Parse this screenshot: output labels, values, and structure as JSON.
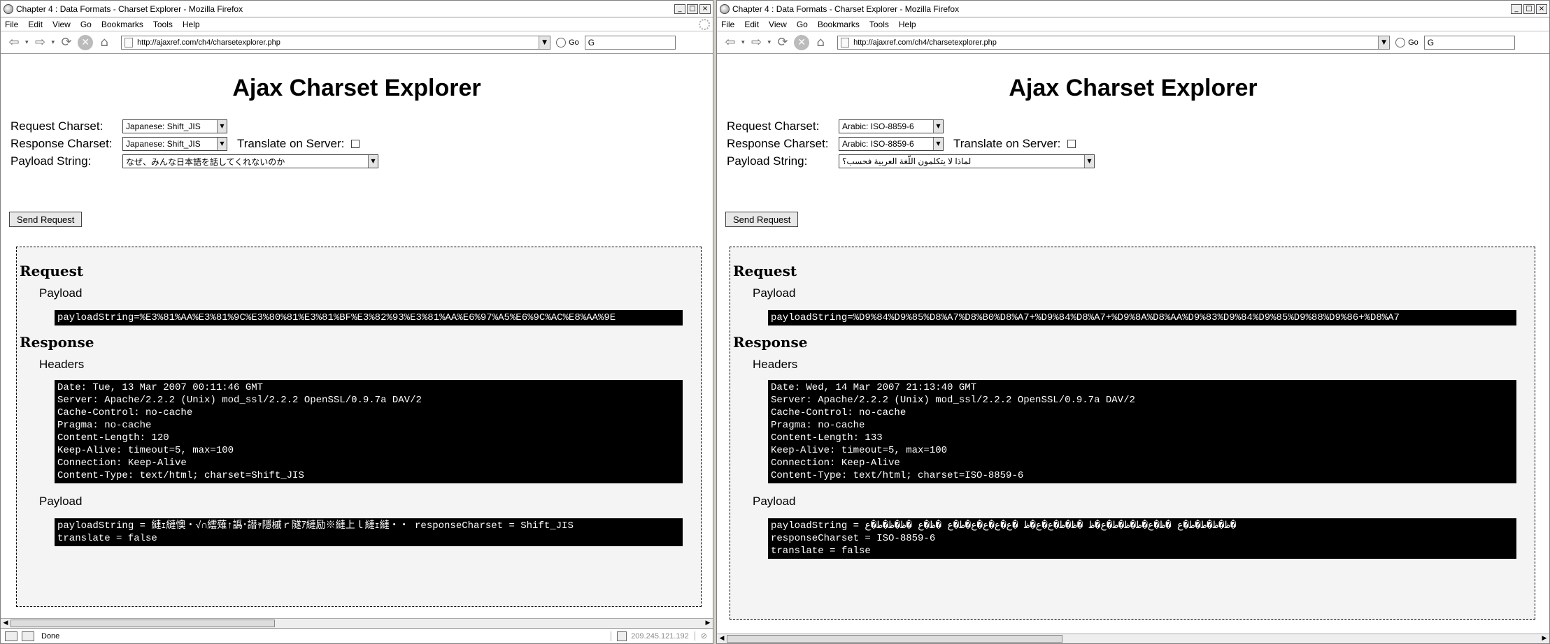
{
  "left": {
    "window_title": "Chapter 4 : Data Formats - Charset Explorer - Mozilla Firefox",
    "menu": [
      "File",
      "Edit",
      "View",
      "Go",
      "Bookmarks",
      "Tools",
      "Help"
    ],
    "url": "http://ajaxref.com/ch4/charsetexplorer.php",
    "go_label": "Go",
    "search_value": "G",
    "heading": "Ajax Charset Explorer",
    "request_charset_label": "Request Charset:",
    "request_charset_value": "Japanese: Shift_JIS",
    "response_charset_label": "Response Charset:",
    "response_charset_value": "Japanese: Shift_JIS",
    "translate_label": "Translate on Server:",
    "translate_checked": false,
    "payload_label": "Payload String:",
    "payload_value": "なぜ、みんな日本語を話してくれないのか",
    "send_button": "Send Request",
    "request_heading": "Request",
    "request_payload_heading": "Payload",
    "request_payload": "payloadString=%E3%81%AA%E3%81%9C%E3%80%81%E3%81%BF%E3%82%93%E3%81%AA%E6%97%A5%E6%9C%AC%E8%AA%9E",
    "response_heading": "Response",
    "headers_heading": "Headers",
    "headers": "Date: Tue, 13 Mar 2007 00:11:46 GMT\nServer: Apache/2.2.2 (Unix) mod_ssl/2.2.2 OpenSSL/0.9.7a DAV/2\nCache-Control: no-cache\nPragma: no-cache\nContent-Length: 120\nKeep-Alive: timeout=5, max=100\nConnection: Keep-Alive\nContent-Type: text/html; charset=Shift_JIS",
    "response_payload_heading": "Payload",
    "response_payload": "payloadString = 縺ｪ縺懊・√∩繧薙↑譌･譛ｬ隱槭ｒ隧ｱ縺励※縺上ｌ縺ｪ縺・・ responseCharset = Shift_JIS\ntranslate = false",
    "status_text": "Done",
    "status_ip": "209.245.121.192"
  },
  "right": {
    "window_title": "Chapter 4 : Data Formats - Charset Explorer - Mozilla Firefox",
    "menu": [
      "File",
      "Edit",
      "View",
      "Go",
      "Bookmarks",
      "Tools",
      "Help"
    ],
    "url": "http://ajaxref.com/ch4/charsetexplorer.php",
    "go_label": "Go",
    "search_value": "G",
    "heading": "Ajax Charset Explorer",
    "request_charset_label": "Request Charset:",
    "request_charset_value": "Arabic: ISO-8859-6",
    "response_charset_label": "Response Charset:",
    "response_charset_value": "Arabic: ISO-8859-6",
    "translate_label": "Translate on Server:",
    "translate_checked": false,
    "payload_label": "Payload String:",
    "payload_value": "لماذا لا يتكلمون اللّغة العربية فحسب؟",
    "send_button": "Send Request",
    "request_heading": "Request",
    "request_payload_heading": "Payload",
    "request_payload": "payloadString=%D9%84%D9%85%D8%A7%D8%B0%D8%A7+%D9%84%D8%A7+%D9%8A%D8%AA%D9%83%D9%84%D9%85%D9%88%D9%86+%D8%A7",
    "response_heading": "Response",
    "headers_heading": "Headers",
    "headers": "Date: Wed, 14 Mar 2007 21:13:40 GMT\nServer: Apache/2.2.2 (Unix) mod_ssl/2.2.2 OpenSSL/0.9.7a DAV/2\nCache-Control: no-cache\nPragma: no-cache\nContent-Length: 133\nKeep-Alive: timeout=5, max=100\nConnection: Keep-Alive\nContent-Type: text/html; charset=ISO-8859-6",
    "response_payload_heading": "Payload",
    "response_payload": "payloadString = ظ�ظ�ط�ط�ع �ظ�ع�ط�ظ�ط�ع�ظ �ظ�ط�ع�ع�ظ �ع�ع�ع�ع�ط�ع �ظ�ع �ظ�ظ�ط�ع�\nresponseCharset = ISO-8859-6\ntranslate = false"
  }
}
